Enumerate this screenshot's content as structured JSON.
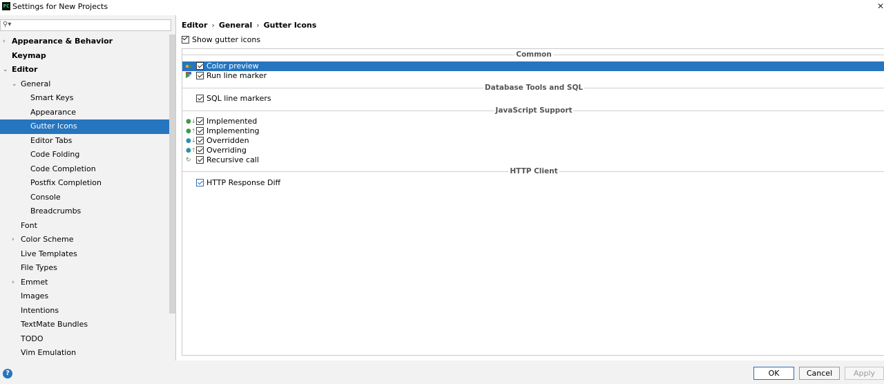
{
  "window": {
    "title": "Settings for New Projects",
    "close_glyph": "✕"
  },
  "search": {
    "placeholder": "",
    "icon": "search-icon"
  },
  "tree": [
    {
      "label": "Appearance & Behavior",
      "indent": 0,
      "arrow": "›",
      "bold": true
    },
    {
      "label": "Keymap",
      "indent": 0,
      "arrow": "",
      "bold": true
    },
    {
      "label": "Editor",
      "indent": 0,
      "arrow": "⌄",
      "bold": true
    },
    {
      "label": "General",
      "indent": 1,
      "arrow": "⌄",
      "bold": false
    },
    {
      "label": "Smart Keys",
      "indent": 2,
      "arrow": "",
      "bold": false
    },
    {
      "label": "Appearance",
      "indent": 2,
      "arrow": "",
      "bold": false
    },
    {
      "label": "Gutter Icons",
      "indent": 2,
      "arrow": "",
      "bold": false,
      "selected": true
    },
    {
      "label": "Editor Tabs",
      "indent": 2,
      "arrow": "",
      "bold": false
    },
    {
      "label": "Code Folding",
      "indent": 2,
      "arrow": "",
      "bold": false
    },
    {
      "label": "Code Completion",
      "indent": 2,
      "arrow": "",
      "bold": false
    },
    {
      "label": "Postfix Completion",
      "indent": 2,
      "arrow": "",
      "bold": false
    },
    {
      "label": "Console",
      "indent": 2,
      "arrow": "",
      "bold": false
    },
    {
      "label": "Breadcrumbs",
      "indent": 2,
      "arrow": "",
      "bold": false
    },
    {
      "label": "Font",
      "indent": 1,
      "arrow": "",
      "bold": false
    },
    {
      "label": "Color Scheme",
      "indent": 1,
      "arrow": "›",
      "bold": false
    },
    {
      "label": "Live Templates",
      "indent": 1,
      "arrow": "",
      "bold": false
    },
    {
      "label": "File Types",
      "indent": 1,
      "arrow": "",
      "bold": false
    },
    {
      "label": "Emmet",
      "indent": 1,
      "arrow": "›",
      "bold": false
    },
    {
      "label": "Images",
      "indent": 1,
      "arrow": "",
      "bold": false
    },
    {
      "label": "Intentions",
      "indent": 1,
      "arrow": "",
      "bold": false
    },
    {
      "label": "TextMate Bundles",
      "indent": 1,
      "arrow": "",
      "bold": false
    },
    {
      "label": "TODO",
      "indent": 1,
      "arrow": "",
      "bold": false
    },
    {
      "label": "Vim Emulation",
      "indent": 1,
      "arrow": "",
      "bold": false
    }
  ],
  "breadcrumb": [
    "Editor",
    "General",
    "Gutter Icons"
  ],
  "breadcrumb_sep": "›",
  "show_gutter_icons": {
    "label": "Show gutter icons",
    "checked": true
  },
  "sections": [
    {
      "title": "Common",
      "items": [
        {
          "label": "Color preview",
          "checked": true,
          "selected": true,
          "icon": "color-palette-icon"
        },
        {
          "label": "Run line marker",
          "checked": true,
          "icon": "run-triangle-icon"
        }
      ]
    },
    {
      "title": "Database Tools and SQL",
      "items": [
        {
          "label": "SQL line markers",
          "checked": true,
          "icon": ""
        }
      ]
    },
    {
      "title": "JavaScript Support",
      "items": [
        {
          "label": "Implemented",
          "checked": true,
          "icon": "implemented-icon"
        },
        {
          "label": "Implementing",
          "checked": true,
          "icon": "implementing-icon"
        },
        {
          "label": "Overridden",
          "checked": true,
          "icon": "overridden-icon"
        },
        {
          "label": "Overriding",
          "checked": true,
          "icon": "overriding-icon"
        },
        {
          "label": "Recursive call",
          "checked": true,
          "icon": "recursive-call-icon"
        }
      ]
    },
    {
      "title": "HTTP Client",
      "items": [
        {
          "label": "HTTP Response Diff",
          "checked": true,
          "icon": "",
          "blue": true
        }
      ]
    }
  ],
  "buttons": {
    "ok": "OK",
    "cancel": "Cancel",
    "apply": "Apply",
    "help": "?"
  },
  "colors": {
    "selection": "#2675bf",
    "accent": "#2a6fb5"
  }
}
